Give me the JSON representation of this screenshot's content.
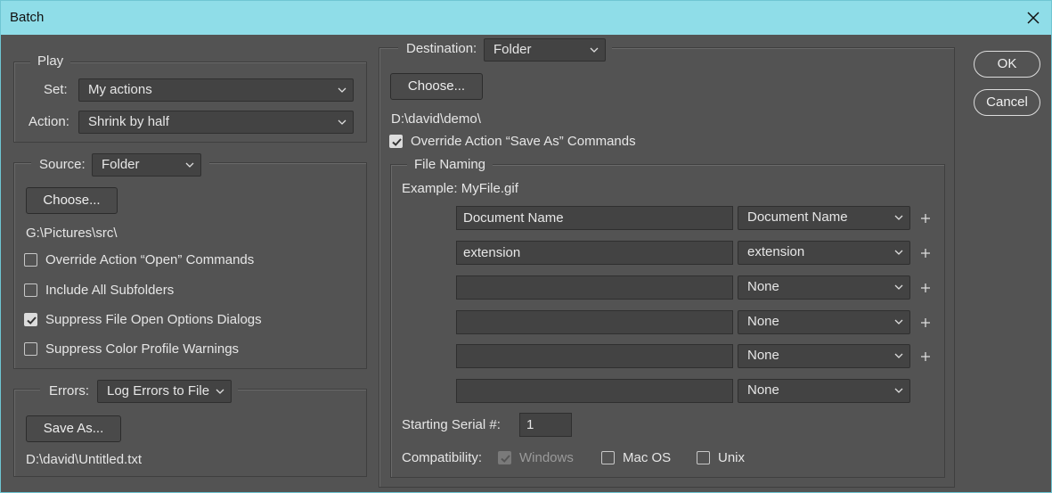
{
  "window": {
    "title": "Batch",
    "close_icon": "close-icon"
  },
  "play": {
    "legend": "Play",
    "set_label": "Set:",
    "set_value": "My actions",
    "action_label": "Action:",
    "action_value": "Shrink by half"
  },
  "source": {
    "label": "Source:",
    "value": "Folder",
    "choose_label": "Choose...",
    "path": "G:\\Pictures\\src\\",
    "options": [
      {
        "label": "Override Action “Open” Commands",
        "checked": false
      },
      {
        "label": "Include All Subfolders",
        "checked": false
      },
      {
        "label": "Suppress File Open Options Dialogs",
        "checked": true
      },
      {
        "label": "Suppress Color Profile Warnings",
        "checked": false
      }
    ]
  },
  "errors": {
    "label": "Errors:",
    "value": "Log Errors to File",
    "save_as_label": "Save As...",
    "path": "D:\\david\\Untitled.txt"
  },
  "destination": {
    "label": "Destination:",
    "value": "Folder",
    "choose_label": "Choose...",
    "path": "D:\\david\\demo\\",
    "override_label": "Override Action “Save As” Commands",
    "override_checked": true
  },
  "file_naming": {
    "legend": "File Naming",
    "example": "Example: MyFile.gif",
    "rows": [
      {
        "text": "Document Name",
        "select": "Document Name",
        "plus": true
      },
      {
        "text": "extension",
        "select": "extension",
        "plus": true
      },
      {
        "text": "",
        "select": "None",
        "plus": true
      },
      {
        "text": "",
        "select": "None",
        "plus": true
      },
      {
        "text": "",
        "select": "None",
        "plus": true
      },
      {
        "text": "",
        "select": "None",
        "plus": false
      }
    ],
    "serial_label": "Starting Serial #:",
    "serial_value": "1",
    "compat_label": "Compatibility:",
    "compat": [
      {
        "label": "Windows",
        "checked": true,
        "disabled": true
      },
      {
        "label": "Mac OS",
        "checked": false,
        "disabled": false
      },
      {
        "label": "Unix",
        "checked": false,
        "disabled": false
      }
    ]
  },
  "buttons": {
    "ok": "OK",
    "cancel": "Cancel"
  }
}
